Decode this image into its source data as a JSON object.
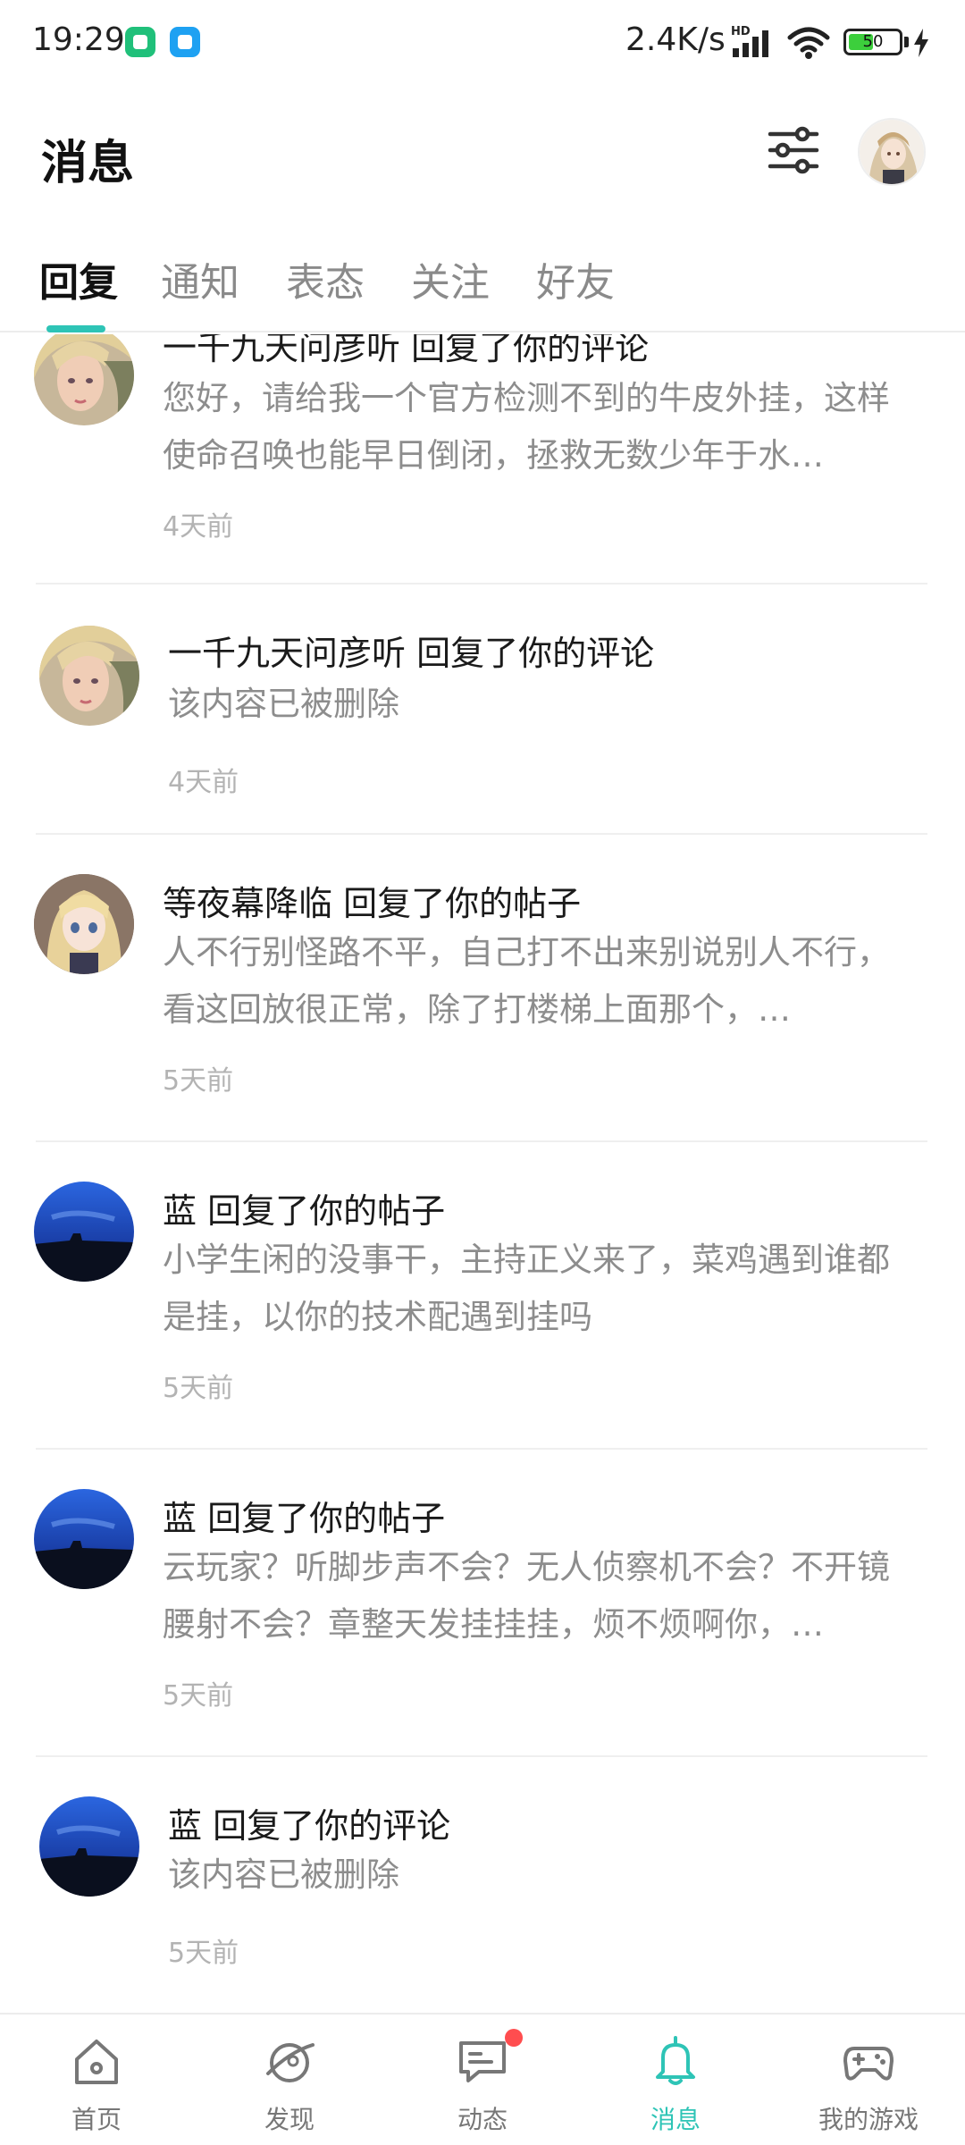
{
  "status_bar": {
    "time": "19:29",
    "net_speed": "2.4K/s",
    "network_badge": "HD",
    "battery_level": "50",
    "battery_fraction": 0.5
  },
  "header": {
    "title": "消息"
  },
  "tabs": [
    {
      "label": "回复",
      "active": true
    },
    {
      "label": "通知",
      "active": false
    },
    {
      "label": "表态",
      "active": false
    },
    {
      "label": "关注",
      "active": false
    },
    {
      "label": "好友",
      "active": false
    }
  ],
  "messages": [
    {
      "title": "一千九天问彦听 回复了你的评论",
      "body": "您好，请给我一个官方检测不到的牛皮外挂，这样使命召唤也能早日倒闭，拯救无数少年于水…",
      "time": "4天前",
      "avatar": "blonde-character-avatar"
    },
    {
      "title": "一千九天问彦听 回复了你的评论",
      "body": "该内容已被删除",
      "time": "4天前",
      "avatar": "blonde-character-avatar"
    },
    {
      "title": "等夜幕降临 回复了你的帖子",
      "body": "人不行别怪路不平，自己打不出来别说别人不行，看这回放很正常，除了打楼梯上面那个，…",
      "time": "5天前",
      "avatar": "anime-girl-avatar"
    },
    {
      "title": "蓝 回复了你的帖子",
      "body": "小学生闲的没事干，主持正义来了，菜鸡遇到谁都是挂，以你的技术配遇到挂吗",
      "time": "5天前",
      "avatar": "blue-sky-avatar"
    },
    {
      "title": "蓝 回复了你的帖子",
      "body": "云玩家？听脚步声不会？无人侦察机不会？不开镜腰射不会？章整天发挂挂挂，烦不烦啊你，…",
      "time": "5天前",
      "avatar": "blue-sky-avatar"
    },
    {
      "title": "蓝 回复了你的评论",
      "body": "该内容已被删除",
      "time": "5天前",
      "avatar": "blue-sky-avatar"
    }
  ],
  "bottom_nav": [
    {
      "label": "首页",
      "icon": "home-icon",
      "active": false
    },
    {
      "label": "发现",
      "icon": "discover-icon",
      "active": false
    },
    {
      "label": "动态",
      "icon": "feed-icon",
      "active": false,
      "badge_dot": true
    },
    {
      "label": "消息",
      "icon": "bell-icon",
      "active": true
    },
    {
      "label": "我的游戏",
      "icon": "gamepad-icon",
      "active": false
    }
  ],
  "colors": {
    "accent": "#2ec4b6",
    "badge_red": "#ff4d4f",
    "text_primary": "#1a1a1a",
    "text_secondary": "#8d8d8d",
    "text_time": "#b3b3b3"
  }
}
